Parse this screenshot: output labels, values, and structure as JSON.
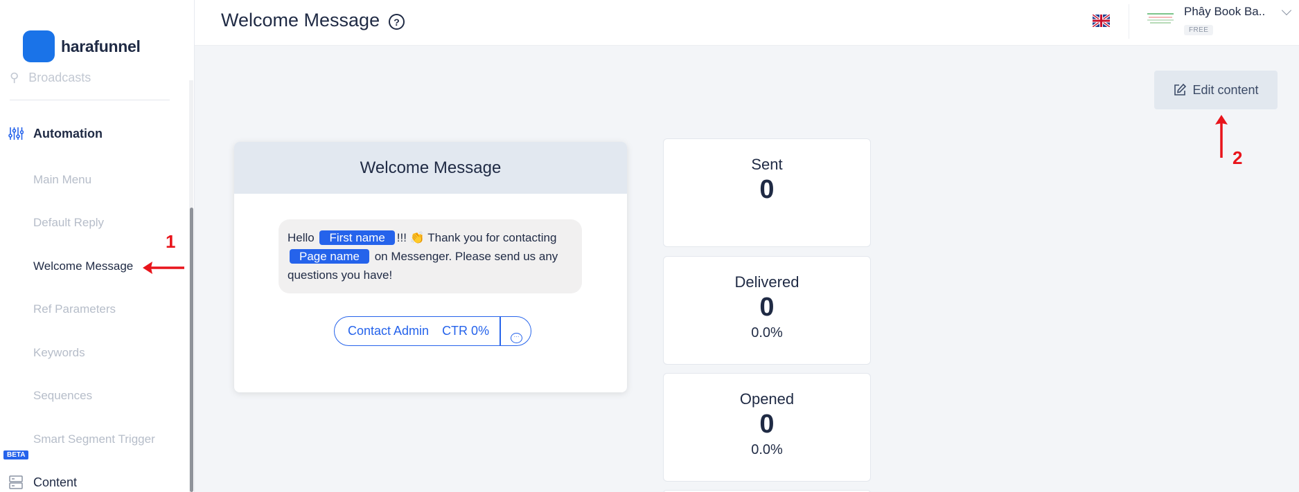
{
  "app": {
    "logo_text": "harafunnel"
  },
  "sidebar": {
    "cut_item": "Broadcasts",
    "section": {
      "label": "Automation"
    },
    "items": [
      {
        "label": "Main Menu",
        "active": false
      },
      {
        "label": "Default Reply",
        "active": false
      },
      {
        "label": "Welcome Message",
        "active": true
      },
      {
        "label": "Ref Parameters",
        "active": false
      },
      {
        "label": "Keywords",
        "active": false
      },
      {
        "label": "Sequences",
        "active": false
      },
      {
        "label": "Smart Segment Trigger",
        "active": false
      }
    ],
    "beta_badge": "BETA",
    "content_label": "Content"
  },
  "header": {
    "title": "Welcome Message",
    "help_glyph": "?",
    "account_name": "Phây Book Ba...",
    "plan": "FREE",
    "language_icon": "uk-flag-icon"
  },
  "toolbar": {
    "edit_label": "Edit content"
  },
  "message": {
    "card_title": "Welcome Message",
    "text_hello": "Hello",
    "tag_first_name": "First name",
    "text_after_first": "!!! 👏 Thank you for contacting",
    "tag_page_name": "Page name",
    "text_after_page": "on Messenger. Please send us any questions you have!",
    "button_label": "Contact Admin",
    "button_ctr": "CTR 0%"
  },
  "stats": {
    "sent": {
      "label": "Sent",
      "value": "0"
    },
    "delivered": {
      "label": "Delivered",
      "value": "0",
      "percent": "0.0%"
    },
    "opened": {
      "label": "Opened",
      "value": "0",
      "percent": "0.0%"
    }
  },
  "annotations": {
    "marker_1": "1",
    "marker_2": "2"
  },
  "colors": {
    "brand": "#1a73e8",
    "tag": "#2563eb",
    "annotation": "#e8141b"
  }
}
